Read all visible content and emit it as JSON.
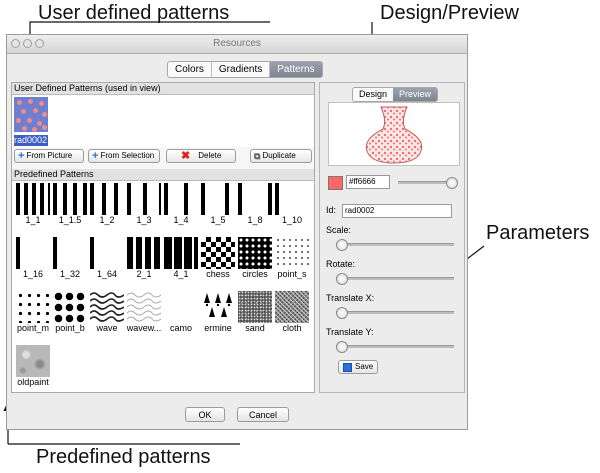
{
  "callouts": {
    "user_defined": "User defined patterns",
    "design_preview": "Design/Preview",
    "parameters": "Parameters",
    "predefined": "Predefined patterns"
  },
  "window": {
    "title": "Resources",
    "tabs": [
      {
        "label": "Colors",
        "active": false
      },
      {
        "label": "Gradients",
        "active": false
      },
      {
        "label": "Patterns",
        "active": true
      }
    ]
  },
  "user_patterns": {
    "header": "User Defined Patterns (used in view)",
    "items": [
      {
        "label": "rad0002"
      }
    ],
    "buttons": {
      "from_picture": "From Picture",
      "from_selection": "From Selection",
      "delete": "Delete",
      "duplicate": "Duplicate"
    }
  },
  "predefined": {
    "header": "Predefined Patterns",
    "items": [
      {
        "label": "1_1"
      },
      {
        "label": "1_1.5"
      },
      {
        "label": "1_2"
      },
      {
        "label": "1_3"
      },
      {
        "label": "1_4"
      },
      {
        "label": "1_5"
      },
      {
        "label": "1_8"
      },
      {
        "label": "1_10"
      },
      {
        "label": "1_16"
      },
      {
        "label": "1_32"
      },
      {
        "label": "1_64"
      },
      {
        "label": "2_1"
      },
      {
        "label": "4_1"
      },
      {
        "label": "chess"
      },
      {
        "label": "circles"
      },
      {
        "label": "point_s"
      },
      {
        "label": "point_m"
      },
      {
        "label": "point_b"
      },
      {
        "label": "wave"
      },
      {
        "label": "wavew..."
      },
      {
        "label": "camo"
      },
      {
        "label": "ermine"
      },
      {
        "label": "sand"
      },
      {
        "label": "cloth"
      },
      {
        "label": "oldpaint"
      }
    ]
  },
  "design": {
    "tabs": [
      {
        "label": "Design",
        "active": false
      },
      {
        "label": "Preview",
        "active": true
      }
    ],
    "color_hex": "#ff6666",
    "id_label": "Id:",
    "id_value": "rad0002",
    "params": [
      {
        "label": "Scale:",
        "value": 0.0
      },
      {
        "label": "Rotate:",
        "value": 0.0
      },
      {
        "label": "Translate X:",
        "value": 0.0
      },
      {
        "label": "Translate Y:",
        "value": 0.0
      }
    ],
    "color_level": 1.0,
    "save_label": "Save"
  },
  "dialog_buttons": {
    "ok": "OK",
    "cancel": "Cancel"
  },
  "colors": {
    "accent": "#ff6666",
    "selection": "#3c5fc2",
    "swatch_bg": "#6e7fcf"
  }
}
